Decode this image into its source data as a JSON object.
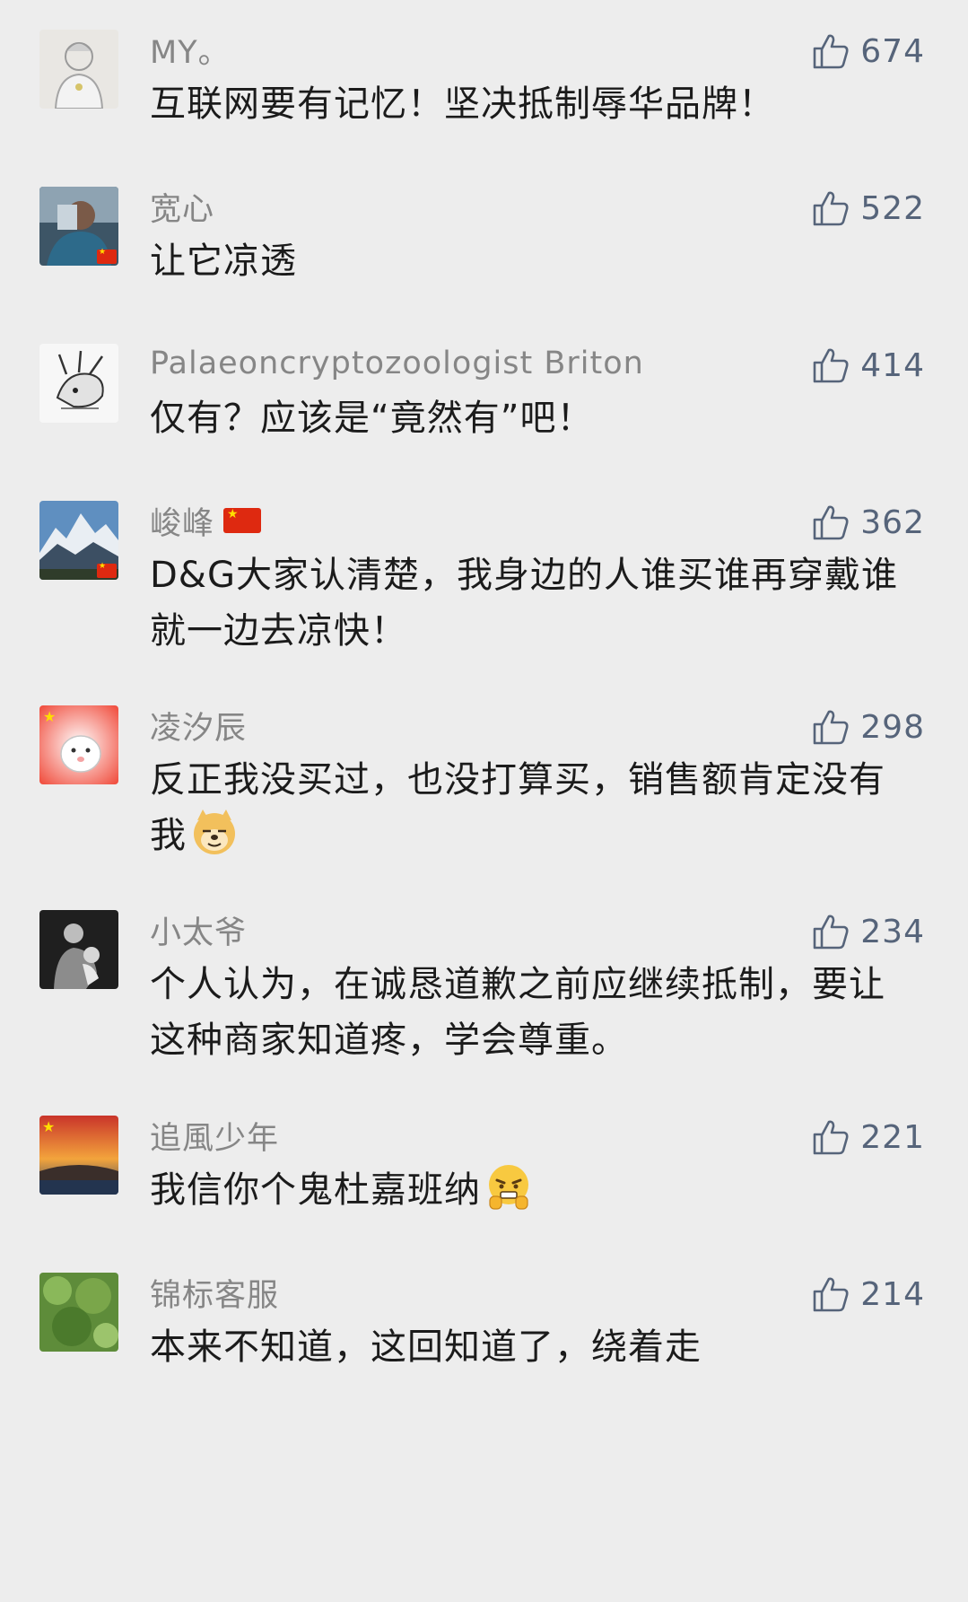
{
  "comments": [
    {
      "name": "MY。",
      "likes": "674",
      "text": "互联网要有记忆！坚决抵制辱华品牌！"
    },
    {
      "name": "宽心",
      "likes": "522",
      "text": "让它凉透"
    },
    {
      "name": "Palaeoncryptozoologist Briton",
      "likes": "414",
      "text": "仅有？应该是“竟然有”吧！"
    },
    {
      "name": "峻峰",
      "likes": "362",
      "text": "D&G大家认清楚，我身边的人谁买谁再穿戴谁就一边去凉快！"
    },
    {
      "name": "凌汐辰",
      "likes": "298",
      "text": "反正我没买过，也没打算买，销售额肯定没有我",
      "emoji": "doge-emoji"
    },
    {
      "name": "小太爷",
      "likes": "234",
      "text": "个人认为，在诚恳道歉之前应继续抵制，要让这种商家知道疼，学会尊重。"
    },
    {
      "name": "追風少年",
      "likes": "221",
      "text": "我信你个鬼杜嘉班纳",
      "emoji": "grimace-emoji"
    },
    {
      "name": "锦标客服",
      "likes": "214",
      "text": "本来不知道，这回知道了，绕着走"
    }
  ],
  "icons": {
    "like": "thumbs-up-icon"
  },
  "colors": {
    "background": "#ededed",
    "name": "#868686",
    "like": "#56647a",
    "text": "#1b1b1b",
    "flag": "#de2910"
  }
}
